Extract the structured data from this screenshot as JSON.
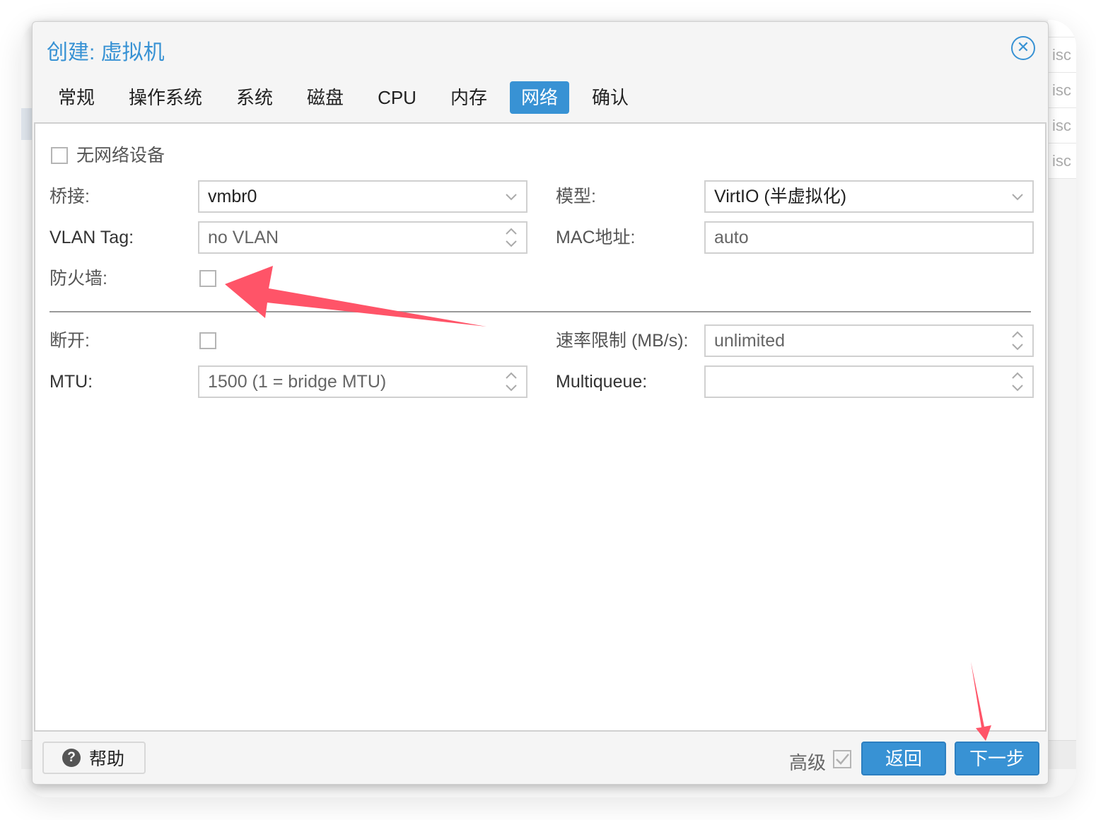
{
  "background": {
    "list_items": [
      "isc",
      "isc",
      "isc",
      "isc"
    ]
  },
  "dialog": {
    "title": "创建: 虚拟机",
    "close_icon": "circle-x-icon",
    "tabs": [
      {
        "label": "常规",
        "active": false
      },
      {
        "label": "操作系统",
        "active": false
      },
      {
        "label": "系统",
        "active": false
      },
      {
        "label": "磁盘",
        "active": false
      },
      {
        "label": "CPU",
        "active": false
      },
      {
        "label": "内存",
        "active": false
      },
      {
        "label": "网络",
        "active": true
      },
      {
        "label": "确认",
        "active": false
      }
    ],
    "no_network_device": {
      "label": "无网络设备",
      "checked": false
    },
    "bridge": {
      "label": "桥接:",
      "value": "vmbr0"
    },
    "model": {
      "label": "模型:",
      "value": "VirtIO (半虚拟化)"
    },
    "vlan_tag": {
      "label": "VLAN Tag:",
      "placeholder": "no VLAN"
    },
    "mac_address": {
      "label": "MAC地址:",
      "placeholder": "auto"
    },
    "firewall": {
      "label": "防火墙:",
      "checked": false
    },
    "disconnect": {
      "label": "断开:",
      "checked": false
    },
    "rate_limit": {
      "label": "速率限制 (MB/s):",
      "placeholder": "unlimited"
    },
    "mtu": {
      "label": "MTU:",
      "placeholder": "1500 (1 = bridge MTU)"
    },
    "multiqueue": {
      "label": "Multiqueue:",
      "value": ""
    },
    "footer": {
      "help_label": "帮助",
      "advanced_label": "高级",
      "advanced_checked": true,
      "back_label": "返回",
      "next_label": "下一步"
    }
  },
  "colors": {
    "accent": "#3892d4",
    "annotation_arrow": "#ff5468"
  }
}
